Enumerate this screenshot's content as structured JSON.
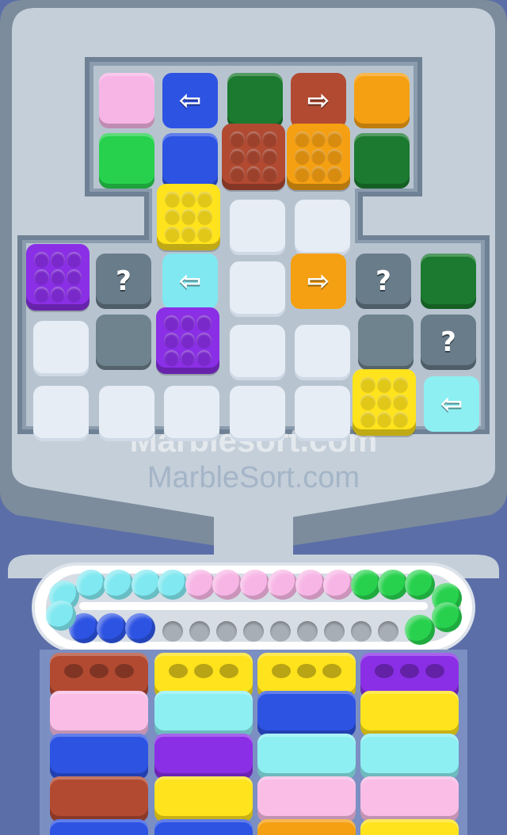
{
  "watermark": {
    "primary": "Marblesort.com",
    "secondary": "MarbleSort.com"
  },
  "icons": {
    "left_arrow": "⇦",
    "right_arrow": "⇨",
    "mystery": "?"
  },
  "colors": {
    "pink": "#f7b5e5",
    "blue": "#2d53e3",
    "dark_green": "#1b7a2f",
    "brown": "#b24a32",
    "orange": "#f5a013",
    "green": "#27d14d",
    "yellow": "#ffe31c",
    "purple": "#8a2fe6",
    "cyan": "#7fe8f0",
    "light_pink": "#f9bde6",
    "light_cyan": "#8deff2"
  },
  "board": {
    "tiles": [
      {
        "name": "tile-pink",
        "color": "pink",
        "kind": "solid"
      },
      {
        "name": "tile-blue-left-arrow",
        "color": "blue",
        "kind": "arrow",
        "dir": "left"
      },
      {
        "name": "tile-darkgreen",
        "color": "dark_green",
        "kind": "solid"
      },
      {
        "name": "tile-brown-right-arrow",
        "color": "brown",
        "kind": "arrow",
        "dir": "right"
      },
      {
        "name": "tile-orange",
        "color": "orange",
        "kind": "solid"
      },
      {
        "name": "tile-green",
        "color": "green",
        "kind": "solid"
      },
      {
        "name": "tile-blue",
        "color": "blue",
        "kind": "solid"
      },
      {
        "name": "marble-box-brown",
        "color": "brown",
        "kind": "box"
      },
      {
        "name": "marble-box-orange",
        "color": "orange",
        "kind": "box"
      },
      {
        "name": "tile-darkgreen-2",
        "color": "dark_green",
        "kind": "solid"
      },
      {
        "name": "marble-box-yellow",
        "color": "yellow",
        "kind": "box"
      },
      {
        "name": "empty-cell",
        "kind": "empty"
      },
      {
        "name": "empty-cell",
        "kind": "empty"
      },
      {
        "name": "marble-box-purple",
        "color": "purple",
        "kind": "box"
      },
      {
        "name": "mystery-tile",
        "kind": "mystery"
      },
      {
        "name": "tile-cyan-left-arrow",
        "color": "cyan",
        "kind": "arrow",
        "dir": "left"
      },
      {
        "name": "empty-cell",
        "kind": "empty"
      },
      {
        "name": "tile-orange-right-arrow",
        "color": "orange",
        "kind": "arrow",
        "dir": "right"
      },
      {
        "name": "mystery-tile",
        "kind": "mystery"
      },
      {
        "name": "tile-darkgreen-3",
        "color": "dark_green",
        "kind": "solid"
      },
      {
        "name": "empty-cell",
        "kind": "empty"
      },
      {
        "name": "gray-cell",
        "kind": "hole-empty"
      },
      {
        "name": "marble-box-purple-2",
        "color": "purple",
        "kind": "box"
      },
      {
        "name": "empty-cell",
        "kind": "empty"
      },
      {
        "name": "empty-cell",
        "kind": "empty"
      },
      {
        "name": "gray-cell",
        "kind": "hole-empty"
      },
      {
        "name": "mystery-tile",
        "kind": "mystery"
      },
      {
        "name": "empty-cell",
        "kind": "empty"
      },
      {
        "name": "empty-cell",
        "kind": "empty"
      },
      {
        "name": "empty-cell",
        "kind": "empty"
      },
      {
        "name": "empty-cell",
        "kind": "empty"
      },
      {
        "name": "empty-cell",
        "kind": "empty"
      },
      {
        "name": "marble-box-yellow-2",
        "color": "yellow",
        "kind": "box"
      },
      {
        "name": "tile-cyan-left-arrow-2",
        "color": "light_cyan",
        "kind": "arrow",
        "dir": "left"
      }
    ]
  },
  "conveyor": {
    "marbles": [
      "cyan",
      "cyan",
      "cyan",
      "cyan",
      "cyan",
      "cyan",
      "pink",
      "pink",
      "pink",
      "pink",
      "pink",
      "pink",
      "green",
      "green",
      "green",
      "green",
      "green",
      "green",
      "blue",
      "blue",
      "blue",
      "cyan"
    ],
    "empty_slots": 9
  },
  "bins": {
    "columns": [
      [
        "brown",
        "light_pink",
        "blue",
        "brown",
        "blue"
      ],
      [
        "yellow",
        "light_cyan",
        "purple",
        "yellow",
        "blue"
      ],
      [
        "yellow",
        "blue",
        "light_cyan",
        "light_pink",
        "orange"
      ],
      [
        "purple",
        "yellow",
        "light_cyan",
        "light_pink",
        "yellow"
      ]
    ]
  }
}
